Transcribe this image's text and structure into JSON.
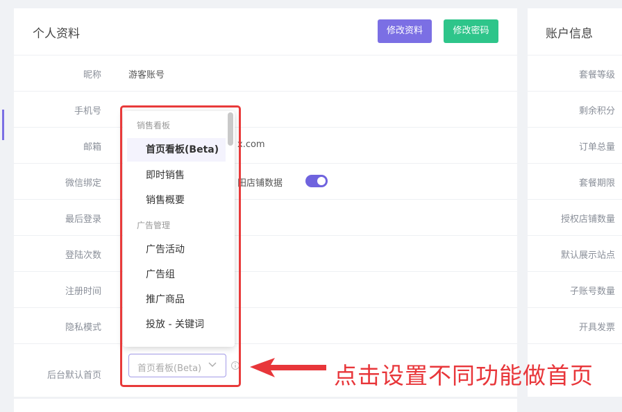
{
  "profile": {
    "title": "个人资料",
    "edit_button": "修改资料",
    "password_button": "修改密码",
    "rows": [
      {
        "label": "昵称",
        "value": "游客账号"
      },
      {
        "label": "手机号",
        "value": ""
      },
      {
        "label": "邮箱",
        "value": "x.com"
      },
      {
        "label": "微信绑定",
        "value": ""
      },
      {
        "label": "最后登录",
        "value": ""
      },
      {
        "label": "登陆次数",
        "value": ""
      },
      {
        "label": "注册时间",
        "value": ""
      },
      {
        "label": "隐私模式",
        "value": ""
      },
      {
        "label": "后台默认首页",
        "value": ""
      }
    ],
    "wechat_toggle_label": "田店铺数据",
    "wechat_toggle_on": true,
    "default_home_select": "首页看板(Beta)"
  },
  "dropdown": {
    "groups": [
      {
        "label": "销售看板",
        "items": [
          "首页看板(Beta)",
          "即时销售",
          "销售概要"
        ]
      },
      {
        "label": "广告管理",
        "items": [
          "广告活动",
          "广告组",
          "推广商品",
          "投放 - 关键词"
        ]
      }
    ],
    "active_item": "首页看板(Beta)"
  },
  "account": {
    "title": "账户信息",
    "rows": [
      "套餐等级",
      "剩余积分",
      "订单总量",
      "套餐期限",
      "授权店铺数量",
      "默认展示站点",
      "子账号数量",
      "开具发票"
    ]
  },
  "annotation": {
    "callout": "点击设置不同功能做首页",
    "color": "#e8363a"
  },
  "colors": {
    "accent": "#7b6fe4",
    "success": "#2ec58a"
  }
}
